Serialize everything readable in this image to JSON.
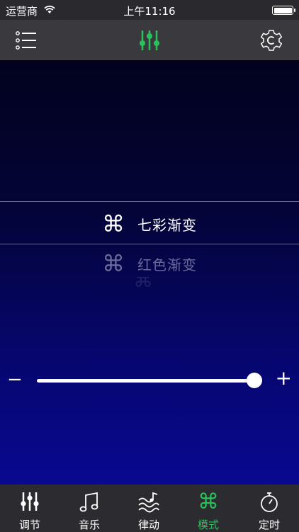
{
  "status_bar": {
    "carrier": "运营商",
    "time": "上午11:16"
  },
  "nav": {
    "left_icon": "list-icon",
    "center_icon": "equalizer-icon",
    "right_icon": "settings-gear-icon",
    "accent": "#29c25a"
  },
  "modes": [
    {
      "icon": "⌘",
      "label": "七彩渐变",
      "selected": true
    },
    {
      "icon": "⌘",
      "label": "红色渐变",
      "selected": false
    },
    {
      "icon": "⌘",
      "label": "",
      "selected": false
    }
  ],
  "slider": {
    "minus": "−",
    "plus": "+",
    "value": 0.97
  },
  "tabs": [
    {
      "icon": "equalizer-icon",
      "label": "调节",
      "active": false
    },
    {
      "icon": "music-note-icon",
      "label": "音乐",
      "active": false
    },
    {
      "icon": "rhythm-waves-icon",
      "label": "律动",
      "active": false
    },
    {
      "icon": "command-key-icon",
      "label": "模式",
      "active": true
    },
    {
      "icon": "stopwatch-icon",
      "label": "定时",
      "active": false
    }
  ],
  "colors": {
    "active_tab": "#29c25a",
    "background_top": "#02021f",
    "background_bottom": "#090991"
  }
}
